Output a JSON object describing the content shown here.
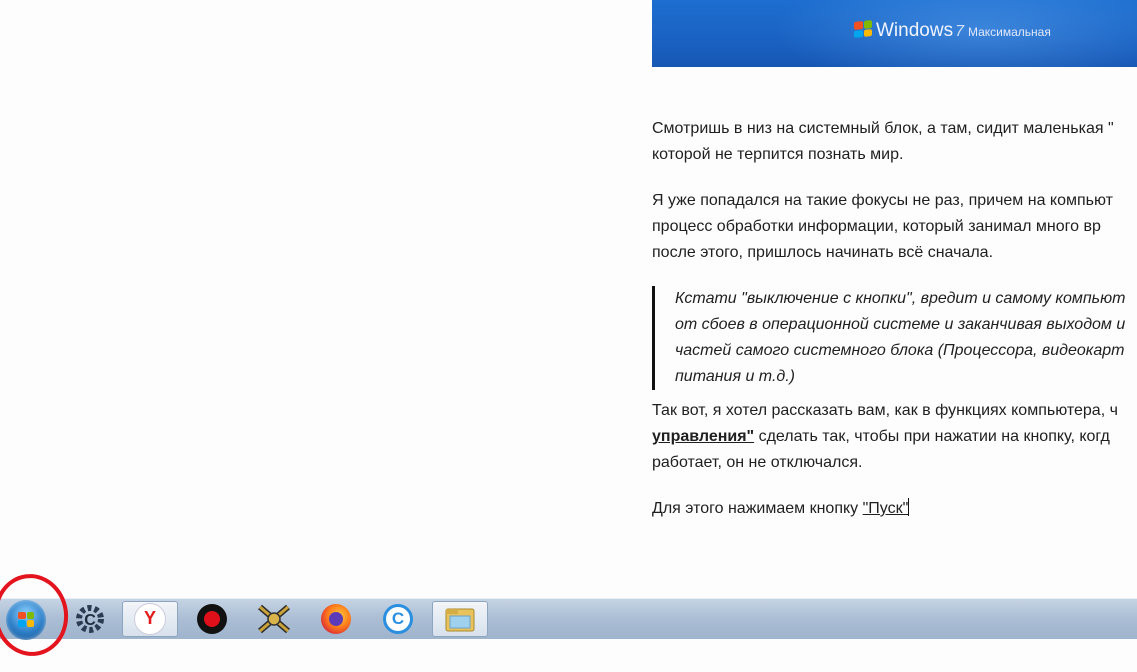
{
  "banner": {
    "brand": "Windows",
    "version": "7",
    "edition": "Максимальная",
    "colors": {
      "bg": "#1a63c4",
      "text": "#eef4ff"
    }
  },
  "article": {
    "p1": "Смотришь в низ на системный блок, а там, сидит маленькая \"",
    "p1b": "которой не терпится познать мир.",
    "p2a": "Я уже попадался на такие фокусы не раз, причем на компьют",
    "p2b": "процесс обработки информации, который занимал много вр",
    "p2c": "после этого, пришлось начинать всё сначала.",
    "quote_a": "Кстати \"выключение с кнопки\", вредит и самому компьют",
    "quote_b": "от сбоев в операционной системе и заканчивая выходом и",
    "quote_c": "частей самого системного блока (Процессора, видеокарт",
    "quote_d": "питания и т.д.)",
    "p3a": "Так вот, я хотел рассказать вам, как в функциях компьютера, ч",
    "p3_link": "управления\"",
    "p3b": " сделать так, чтобы при нажатии на кнопку, когд",
    "p3c": "работает, он не отключался.",
    "p4": "Для этого нажимаем кнопку ",
    "p4_link": "\"Пуск\""
  },
  "taskbar": {
    "items": [
      {
        "name": "start-button",
        "icon": "windows-orb-icon"
      },
      {
        "name": "ccleaner",
        "icon": "ccleaner-icon"
      },
      {
        "name": "yandex-browser",
        "icon": "yandex-icon",
        "letter": "Y"
      },
      {
        "name": "recorder",
        "icon": "record-icon"
      },
      {
        "name": "launcher",
        "icon": "game-launcher-icon"
      },
      {
        "name": "firefox",
        "icon": "firefox-icon"
      },
      {
        "name": "cclean-c",
        "icon": "c-app-icon",
        "letter": "C"
      },
      {
        "name": "explorer",
        "icon": "folder-icon"
      }
    ]
  },
  "colors": {
    "annotation": "#e3141e",
    "taskbar": "#aabdd4"
  }
}
